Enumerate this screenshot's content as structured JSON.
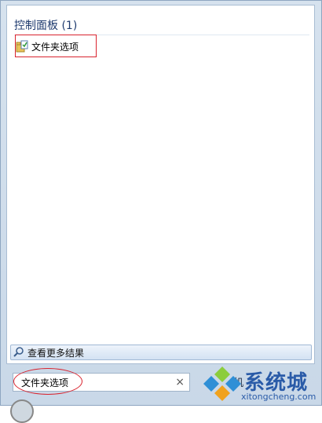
{
  "results": {
    "group_header": "控制面板 (1)",
    "items": [
      {
        "label": "文件夹选项",
        "icon": "folder-options-icon"
      }
    ]
  },
  "see_more": {
    "label": "查看更多结果",
    "icon": "search-icon"
  },
  "search": {
    "value": "文件夹选项",
    "clear_icon": "×"
  },
  "shutdown": {
    "label_fragment": "机"
  },
  "watermark": {
    "brand": "系统城",
    "domain": "xitongcheng.com"
  },
  "colors": {
    "annotation_red": "#d9232e",
    "header_blue": "#1e3a6e",
    "frame_blue": "#c9d8e8",
    "watermark_blue": "#2a5ba8"
  }
}
